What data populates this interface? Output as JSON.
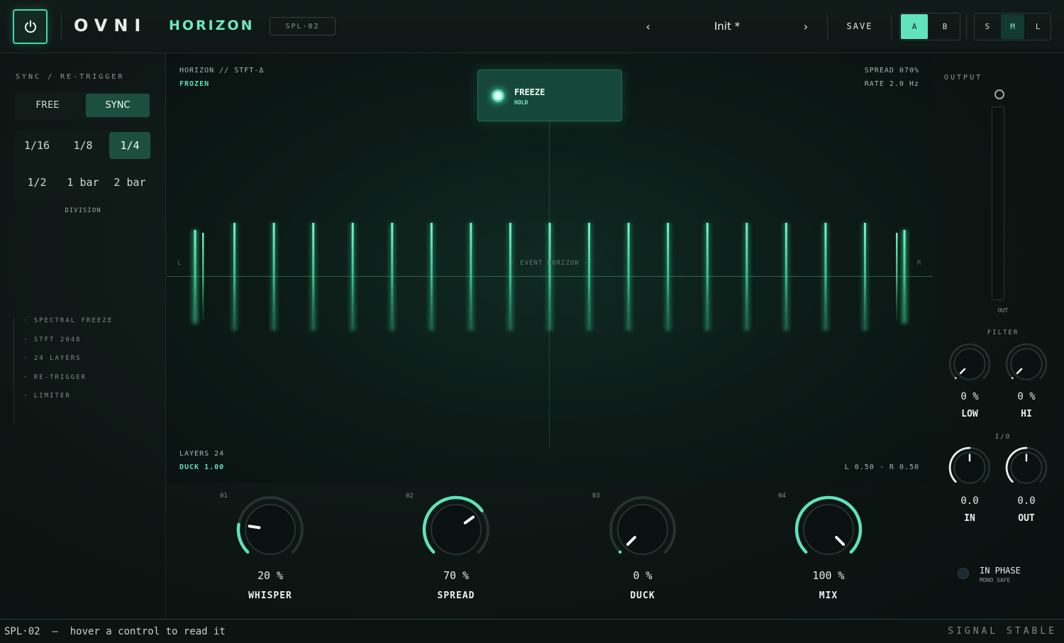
{
  "header": {
    "brand": "OVNI",
    "product": "HORIZON",
    "model_tag": "SPL·02",
    "preset_prev": "‹",
    "preset_name": "Init *",
    "preset_next": "›",
    "save_label": "SAVE",
    "ab": [
      {
        "label": "A",
        "active": true
      },
      {
        "label": "B",
        "active": false
      }
    ],
    "size": [
      {
        "label": "S",
        "active": false
      },
      {
        "label": "M",
        "active": true
      },
      {
        "label": "L",
        "active": false
      }
    ]
  },
  "left": {
    "title": "SYNC / RE-TRIGGER",
    "modes": {
      "free": "FREE",
      "sync": "SYNC",
      "active": "SYNC"
    },
    "divisions": [
      "1/16",
      "1/8",
      "1/4",
      "1/2",
      "1 bar",
      "2 bar"
    ],
    "active_division": "1/4",
    "division_label": "DIVISION",
    "features": [
      "· SPECTRAL FREEZE",
      "· STFT 2048",
      "· 24 LAYERS",
      "· RE-TRIGGER",
      "· LIMITER"
    ]
  },
  "display": {
    "engine": "HORIZON // STFT-Δ",
    "state": "FROZEN",
    "spread": "SPREAD 070%",
    "rate": "RATE 2.0 Hz",
    "freeze_label": "FREEZE",
    "freeze_sub": "HOLD",
    "event_label": "· EVENT HORIZON ·",
    "edge_left": "L",
    "edge_right": "R",
    "layers": "LAYERS 24",
    "duck": "DUCK 1.00",
    "balance": "L 0.50 · R 0.50",
    "bar_count": 19
  },
  "knobs": [
    {
      "index": "01",
      "value": "20 %",
      "name": "WHISPER",
      "level": 0.2
    },
    {
      "index": "02",
      "value": "70 %",
      "name": "SPREAD",
      "level": 0.7
    },
    {
      "index": "03",
      "value": "0 %",
      "name": "DUCK",
      "level": 0.0
    },
    {
      "index": "04",
      "value": "100 %",
      "name": "MIX",
      "level": 1.0
    }
  ],
  "right": {
    "output_title": "OUTPUT",
    "meter_label": "OUT",
    "filter_title": "FILTER",
    "filter": [
      {
        "value": "0 %",
        "name": "LOW"
      },
      {
        "value": "0 %",
        "name": "HI"
      }
    ],
    "io_title": "I/O",
    "io": [
      {
        "value": "0.0",
        "name": "IN"
      },
      {
        "value": "0.0",
        "name": "OUT"
      }
    ],
    "phase_label": "IN PHASE",
    "phase_sub": "MONO SAFE"
  },
  "footer": {
    "status": "SPL·02  —  hover a control to read it",
    "signal": "SIGNAL STABLE"
  },
  "colors": {
    "accent": "#5fe2b7",
    "accent_dim": "#1c4f3e",
    "bg": "#0c1412"
  }
}
